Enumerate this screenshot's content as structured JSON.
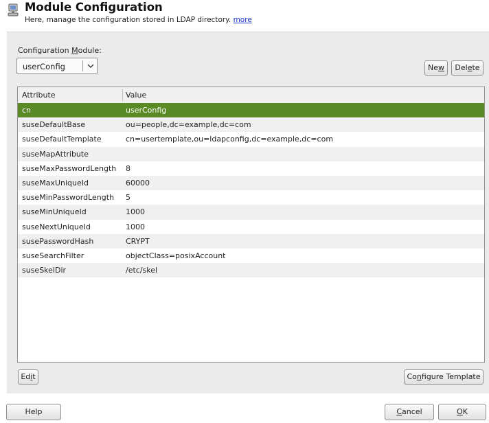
{
  "header": {
    "title": "Module Configuration",
    "subtitle": "Here, manage the configuration stored in LDAP directory.",
    "more_link": "more",
    "icon": "computer-icon"
  },
  "config_module": {
    "label_before": "Configuration ",
    "label_mnemonic": "M",
    "label_after": "odule:",
    "selected": "userConfig"
  },
  "buttons": {
    "new_pre": "Ne",
    "new_u": "w",
    "new_post": "",
    "delete_pre": "Del",
    "delete_u": "e",
    "delete_post": "te",
    "edit_pre": "Ed",
    "edit_u": "i",
    "edit_post": "t",
    "configure_pre": "Co",
    "configure_u": "n",
    "configure_post": "figure Template",
    "help": "Help",
    "cancel_u": "C",
    "cancel_post": "ancel",
    "ok_u": "O",
    "ok_post": "K"
  },
  "table": {
    "columns": [
      "Attribute",
      "Value"
    ],
    "selected_row": 0,
    "selection_color": "#5a8a26",
    "rows": [
      {
        "attribute": "cn",
        "value": "userConfig"
      },
      {
        "attribute": "suseDefaultBase",
        "value": "ou=people,dc=example,dc=com"
      },
      {
        "attribute": "suseDefaultTemplate",
        "value": "cn=usertemplate,ou=ldapconfig,dc=example,dc=com"
      },
      {
        "attribute": "suseMapAttribute",
        "value": ""
      },
      {
        "attribute": "suseMaxPasswordLength",
        "value": "8"
      },
      {
        "attribute": "suseMaxUniqueId",
        "value": "60000"
      },
      {
        "attribute": "suseMinPasswordLength",
        "value": "5"
      },
      {
        "attribute": "suseMinUniqueId",
        "value": "1000"
      },
      {
        "attribute": "suseNextUniqueId",
        "value": "1000"
      },
      {
        "attribute": "susePasswordHash",
        "value": "CRYPT"
      },
      {
        "attribute": "suseSearchFilter",
        "value": "objectClass=posixAccount"
      },
      {
        "attribute": "suseSkelDir",
        "value": "/etc/skel"
      }
    ]
  }
}
